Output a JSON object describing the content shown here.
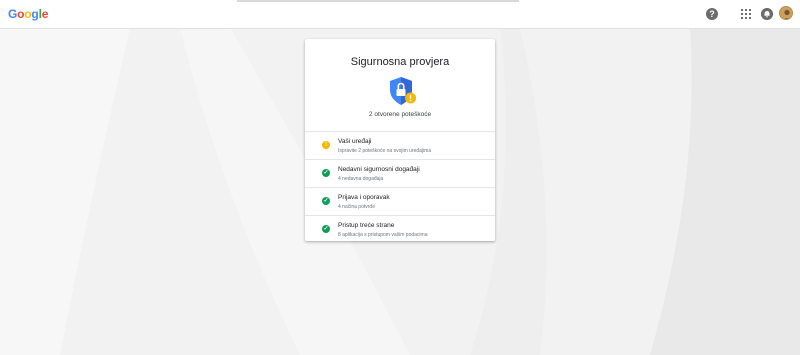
{
  "header": {
    "logo_letters": [
      {
        "char": "G",
        "color": "#4285f4"
      },
      {
        "char": "o",
        "color": "#ea4335"
      },
      {
        "char": "o",
        "color": "#fbbc05"
      },
      {
        "char": "g",
        "color": "#4285f4"
      },
      {
        "char": "l",
        "color": "#34a853"
      },
      {
        "char": "e",
        "color": "#ea4335"
      }
    ],
    "help_glyph": "?",
    "icons": [
      "help-icon",
      "apps-icon",
      "notifications-icon",
      "avatar"
    ]
  },
  "card": {
    "title": "Sigurnosna provjera",
    "issues_summary": "2 otvorene poteškoće",
    "shield_color": "#4285f4",
    "badge_color": "#f5b800",
    "items": [
      {
        "status": "warning",
        "title": "Vaši uređaji",
        "subtitle": "Ispravite 2 poteškoće na svojim uređajima"
      },
      {
        "status": "ok",
        "title": "Nedavni sigurnosni događaji",
        "subtitle": "4 nedavna događaja"
      },
      {
        "status": "ok",
        "title": "Prijava i oporavak",
        "subtitle": "4 načina potvrde"
      },
      {
        "status": "ok",
        "title": "Pristup treće strane",
        "subtitle": "8 aplikacija s pristupom vašim podacima"
      }
    ]
  },
  "colors": {
    "ok": "#0f9d58",
    "warning": "#f5b800"
  }
}
